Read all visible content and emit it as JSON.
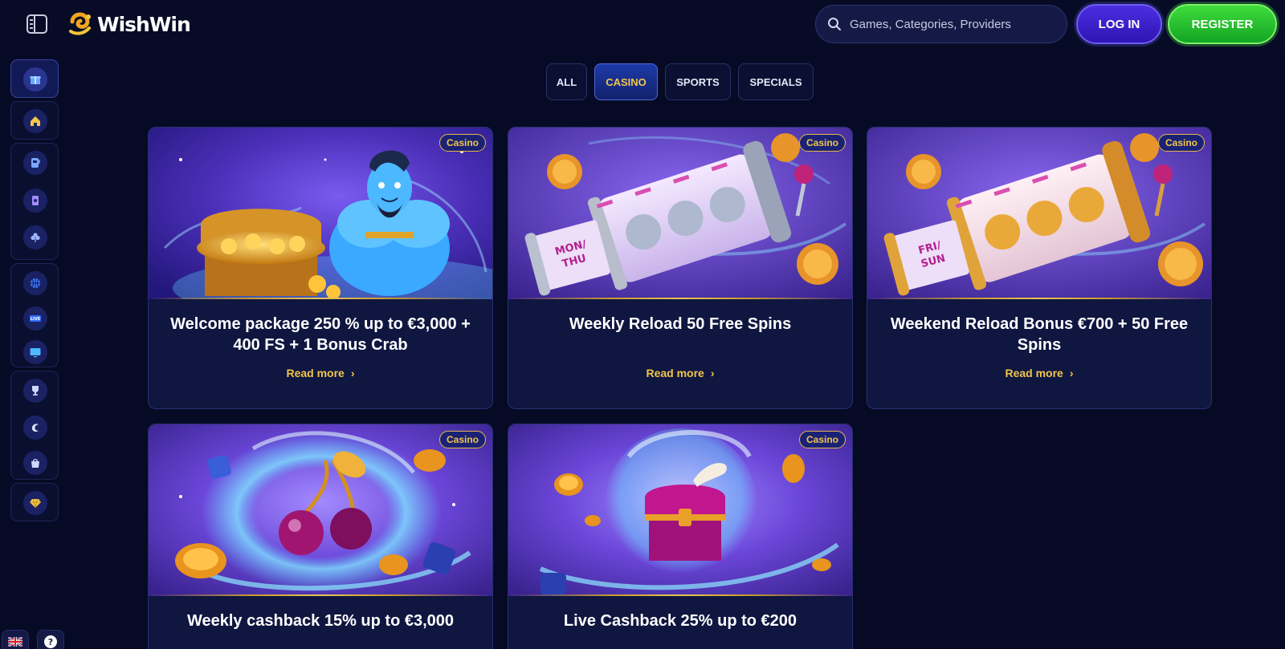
{
  "header": {
    "brand": "WishWin",
    "search_placeholder": "Games, Categories, Providers",
    "login_label": "LOG IN",
    "register_label": "REGISTER"
  },
  "sidebar": {
    "items": [
      {
        "icon": "gift-icon"
      },
      {
        "icon": "home-icon"
      },
      {
        "icon": "slot-machine-icon"
      },
      {
        "icon": "cards-icon"
      },
      {
        "icon": "clover-icon"
      },
      {
        "icon": "basketball-icon"
      },
      {
        "icon": "live-icon",
        "label": "LIVE"
      },
      {
        "icon": "tv-icon"
      },
      {
        "icon": "trophy-icon"
      },
      {
        "icon": "crescent-icon"
      },
      {
        "icon": "shop-bag-icon"
      },
      {
        "icon": "diamond-icon"
      }
    ],
    "language_flag": "uk-flag-icon",
    "help_label": "?"
  },
  "filters": {
    "tabs": [
      "ALL",
      "CASINO",
      "SPORTS",
      "SPECIALS"
    ],
    "active": "CASINO"
  },
  "promotions": [
    {
      "badge": "Casino",
      "title": "Welcome package 250 % up to €3,000 + 400 FS + 1 Bonus Crab",
      "link": "Read more",
      "art": "genie-treasure"
    },
    {
      "badge": "Casino",
      "title": "Weekly Reload 50 Free Spins",
      "link": "Read more",
      "art": "silver-reel",
      "scroll_text": "MON/ THU"
    },
    {
      "badge": "Casino",
      "title": "Weekend Reload Bonus €700 + 50 Free Spins",
      "link": "Read more",
      "art": "gold-reel",
      "scroll_text": "FRI/ SUN"
    },
    {
      "badge": "Casino",
      "title": "Weekly cashback 15% up to €3,000",
      "link": "",
      "art": "cherries"
    },
    {
      "badge": "Casino",
      "title": "Live Cashback 25% up to €200",
      "link": "",
      "art": "chest"
    }
  ],
  "colors": {
    "background": "#060a24",
    "accent_gold": "#f1c54a",
    "login": "#3a1fd0",
    "register": "#22c030"
  }
}
